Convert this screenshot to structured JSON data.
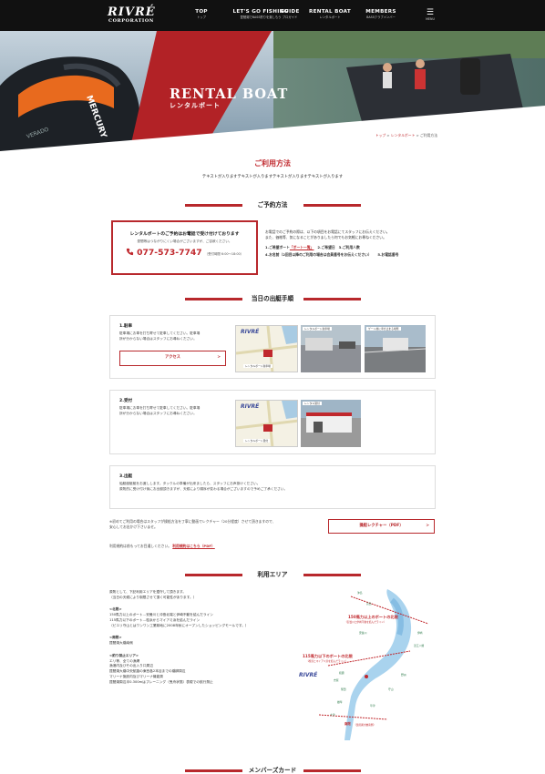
{
  "header": {
    "logo_main": "RIVRÉ",
    "logo_sub": "CORPORATION",
    "nav": [
      {
        "title": "TOP",
        "sub": "トップ"
      },
      {
        "title": "LET'S GO FISHING",
        "sub": "琵琶湖でBASS釣りを楽しもう"
      },
      {
        "title": "GUIDE",
        "sub": "プロガイド"
      },
      {
        "title": "RENTAL BOAT",
        "sub": "レンタルボート"
      },
      {
        "title": "MEMBERS",
        "sub": "BASSクラブメンバー"
      }
    ],
    "menu_label": "MENU",
    "menu_glyph": "☰"
  },
  "hero": {
    "title_en": "RENTAL BOAT",
    "title_ja": "レンタルボート",
    "engine_text": "MERCURY"
  },
  "breadcrumb": {
    "items": [
      "トップ",
      "レンタルボート",
      "ご利用方法"
    ],
    "separator": ">"
  },
  "page": {
    "title": "ご利用方法",
    "lead": "テキストが入りますテキストが入りますテキストが入りますテキストが入ります"
  },
  "reservation": {
    "section_title": "ご予約方法",
    "box_heading": "レンタルボートのご予約はお電話で受け付けております",
    "box_note": "昼間等はつながりにくい場合がございますが、ご容赦ください。",
    "phone_icon": "phone-icon",
    "phone": "077-573-7747",
    "hours": "（受付時間 6:00～18:00）",
    "info_line1": "お電話でのご予約の際は、以下の項目をお電話にてスタッフにお伝えください。",
    "info_line2": "また、価格等、気になることがありましたら何でもお気軽にお尋ねください。",
    "step1_label": "1.ご希望ボート",
    "step1_link": "「ボート一覧」",
    "step2": "2.ご希望日",
    "step3": "3.ご利用人数",
    "step4": "4.お名前（2回目以降のご利用の場合は会員番号をお伝えください）",
    "step5": "5.お電話番号"
  },
  "departure": {
    "section_title": "当日の出艇手順",
    "steps": [
      {
        "title": "1.駐車",
        "desc1": "駐車場にお車を打ち寄せて駐車してください。駐車場",
        "desc2": "所が分からない場合はスタッフにお尋ねください。",
        "button": "アクセス",
        "button_arrow": ">",
        "map_logo": "RIVRÉ",
        "map_caption": "レンタルボート駐車場",
        "photo1_caption": "レンタルボート駐車場",
        "photo2_caption": "ゲート前に車が止まる場所"
      },
      {
        "title": "2.受付",
        "desc1": "駐車場にお車を打ち寄せて駐車してください。駐車場",
        "desc2": "所が分からない場合はスタッフにお尋ねください。",
        "map_logo": "RIVRÉ",
        "map_caption": "レンタルボート受付",
        "photo1_caption": "レンタル受付"
      },
      {
        "title": "3.出艇",
        "desc1": "船艇艇艇艇をお渡しします。タックルの準備が出来ましたら、スタッフにお声掛けください。",
        "desc2": "原則的に受け付け後にお出艇頂きますが、天候により順序が変わる場合がございますので予めご了承ください。"
      }
    ],
    "note1": "※初めてご利用の場合はスタッフが操船方法を丁寧に動画でレクチャー（20分程度）させて頂きますので、",
    "note2": "安心してお出かけ下さいませ。",
    "lecture_button": "操船レクチャー（PDF）",
    "lecture_arrow": ">",
    "terms_text": "利用規約は前もってお目通しください。",
    "terms_link": "利用規約はこちら（PDF）"
  },
  "area": {
    "section_title": "利用エリア",
    "intro1": "原則として、下記利用エリアを遵守して頂きます。",
    "intro2": "（当日の天候により制限させて頂く可能性があります。）",
    "north_h": "<北限>",
    "north1": "150馬力以上のボート…安曇川と沖島北端と伊崎不動を結んだライン",
    "north2": "115馬力以下のボート…桂浜からマイアミ浜を結んだライン",
    "north3": "（ピエリ守山とはワンワン工業跡地に2008年秋にオープンしたショッピングモールです。）",
    "south_h": "<南限>",
    "south1": "琵琶湖大橋南側",
    "forbid_h": "<釣り禁止エリア>",
    "forbid": [
      "エリ等、全ての漁網",
      "漁港内及びその出入り口周辺",
      "琵琶湖大橋中央航路の東西各2本目までの橋脚周辺",
      "マリーナ施設内及びマリーナ機能周",
      "琵琶湖周辺半0.300mはプレーニング（曳舟状態）表現での航行禁止"
    ],
    "map_label1": "150馬力以上のボートの北限",
    "map_label1_sub": "（安曇川と伊崎不動を結んだライン）",
    "map_label2": "115馬力以下のボートの北限",
    "map_label2_sub": "（桂浜とマイアミ浜を結んだライン）",
    "map_label3": "南限",
    "map_label3_sub": "（琵琶湖大橋南側）",
    "map_logo": "RIVRÉ",
    "places": [
      "沖島",
      "高島",
      "安曇川",
      "伊崎",
      "近江八幡",
      "野洲",
      "守山",
      "大津",
      "堅田",
      "雄琴",
      "草津",
      "志賀",
      "和邇"
    ]
  },
  "members": {
    "section_title": "メンバーズカード"
  },
  "colors": {
    "accent": "#b8282c",
    "header_bg": "#111111",
    "map_green": "#2d7a4a"
  }
}
